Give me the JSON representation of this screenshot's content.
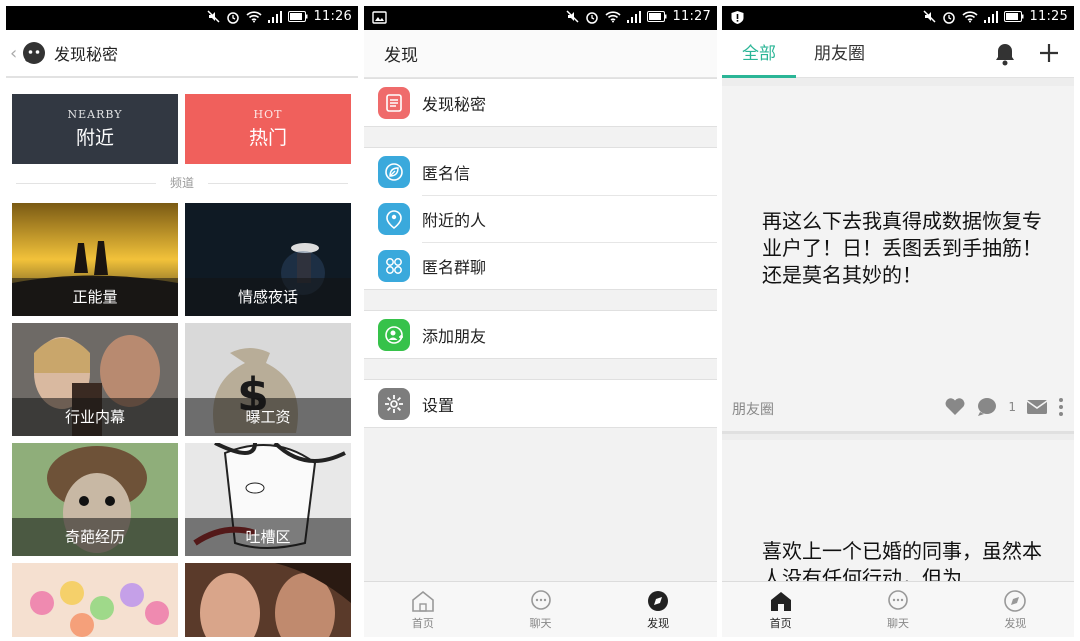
{
  "screens": [
    {
      "status": {
        "time": "11:26"
      },
      "header": {
        "title": "发现秘密"
      },
      "top_tiles": [
        {
          "en": "NEARBY",
          "cn": "附近"
        },
        {
          "en": "HOT",
          "cn": "热门"
        }
      ],
      "section_label": "频道",
      "channels": [
        "正能量",
        "情感夜话",
        "行业内幕",
        "曝工资",
        "奇葩经历",
        "吐槽区"
      ]
    },
    {
      "status": {
        "time": "11:27"
      },
      "header": {
        "title": "发现"
      },
      "menu": [
        {
          "label": "发现秘密",
          "icon": "note-icon"
        },
        {
          "label": "匿名信",
          "icon": "leaf-icon"
        },
        {
          "label": "附近的人",
          "icon": "location-person-icon"
        },
        {
          "label": "匿名群聊",
          "icon": "grid-icon"
        },
        {
          "label": "添加朋友",
          "icon": "add-person-icon"
        },
        {
          "label": "设置",
          "icon": "gear-icon"
        }
      ],
      "tabbar": [
        {
          "label": "首页",
          "icon": "home-icon"
        },
        {
          "label": "聊天",
          "icon": "chat-icon"
        },
        {
          "label": "发现",
          "icon": "compass-icon"
        }
      ],
      "active_tab": "发现"
    },
    {
      "status": {
        "time": "11:25"
      },
      "tabs": {
        "active": "全部",
        "other": "朋友圈"
      },
      "posts": [
        {
          "text": "再这么下去我真得成数据恢复专业户了！日！丢图丢到手抽筋！还是莫名其妙的！",
          "source": "朋友圈",
          "comments": "1"
        },
        {
          "text": "喜欢上一个已婚的同事，虽然本人没有任何行动，但为"
        }
      ],
      "tabbar": [
        {
          "label": "首页",
          "icon": "home-icon"
        },
        {
          "label": "聊天",
          "icon": "chat-icon"
        },
        {
          "label": "发现",
          "icon": "compass-icon"
        }
      ],
      "active_tab": "首页"
    }
  ],
  "colors": {
    "accent_green": "#2bb596",
    "hot_red": "#f0605c",
    "nearby_dark": "#323842",
    "menu_red": "#ef6b6b",
    "menu_blue": "#3aa9dc",
    "menu_green": "#36c24a",
    "menu_gray": "#7d7d7d"
  }
}
